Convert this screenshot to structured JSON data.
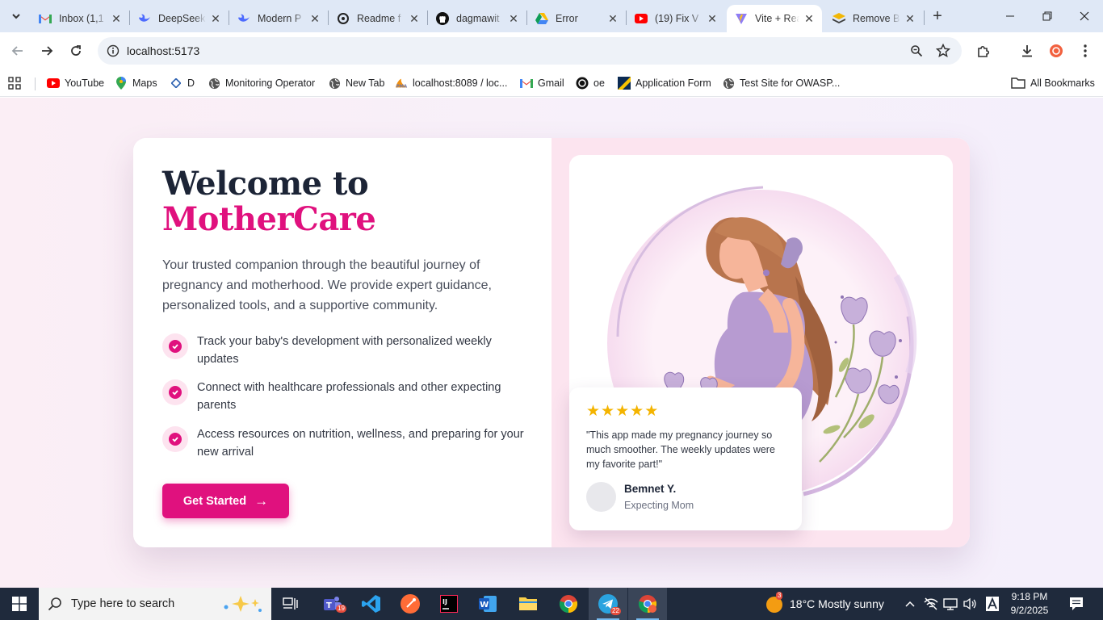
{
  "browser": {
    "tabs": [
      {
        "title": "Inbox (1,1",
        "icon": "gmail-icon"
      },
      {
        "title": "DeepSeek",
        "icon": "deepseek-icon"
      },
      {
        "title": "Modern P",
        "icon": "deepseek-icon"
      },
      {
        "title": "Readme f",
        "icon": "openai-icon"
      },
      {
        "title": "dagmawit",
        "icon": "github-icon"
      },
      {
        "title": "Error",
        "icon": "google-drive-icon"
      },
      {
        "title": "(19) Fix V",
        "icon": "youtube-icon"
      },
      {
        "title": "Vite + Rea",
        "icon": "vite-icon",
        "active": true
      },
      {
        "title": "Remove B",
        "icon": "remove-bg-icon"
      }
    ],
    "url": "localhost:5173",
    "bookmarks": [
      {
        "label": "YouTube",
        "icon": "youtube-icon"
      },
      {
        "label": "Maps",
        "icon": "maps-icon"
      },
      {
        "label": "D",
        "icon": "diamond-icon"
      },
      {
        "label": "Monitoring Operator",
        "icon": "globe-icon"
      },
      {
        "label": "New Tab",
        "icon": "globe-icon"
      },
      {
        "label": "localhost:8089 / loc...",
        "icon": "phpmyadmin-icon"
      },
      {
        "label": "Gmail",
        "icon": "gmail-icon"
      },
      {
        "label": "oe",
        "icon": "openai-icon"
      },
      {
        "label": "Application Form",
        "icon": "form-icon"
      },
      {
        "label": "Test Site for OWASP...",
        "icon": "globe-icon"
      }
    ],
    "all_bookmarks": "All Bookmarks"
  },
  "hero": {
    "title_line1": "Welcome to",
    "title_line2": "MotherCare",
    "intro": "Your trusted companion through the beautiful journey of pregnancy and motherhood. We provide expert guidance, personalized tools, and a supportive community.",
    "features": [
      "Track your baby's development with personalized weekly updates",
      "Connect with healthcare professionals and other expecting parents",
      "Access resources on nutrition, wellness, and preparing for your new arrival"
    ],
    "cta_label": "Get Started",
    "cta_arrow": "→"
  },
  "testimonial": {
    "rating": 5,
    "stars": "★★★★★",
    "quote": "\"This app made my pregnancy journey so much smoother. The weekly updates were my favorite part!\"",
    "author": "Bemnet Y.",
    "role": "Expecting Mom"
  },
  "taskbar": {
    "search_placeholder": "Type here to search",
    "teams_badge": "19",
    "telegram_badge": "22",
    "weather_badge": "3",
    "weather": "18°C  Mostly sunny",
    "time": "9:18 PM",
    "date": "9/2/2025"
  },
  "colors": {
    "brand": "#e0117e",
    "heading": "#1c2436",
    "panel_pink": "#fce4ef"
  }
}
